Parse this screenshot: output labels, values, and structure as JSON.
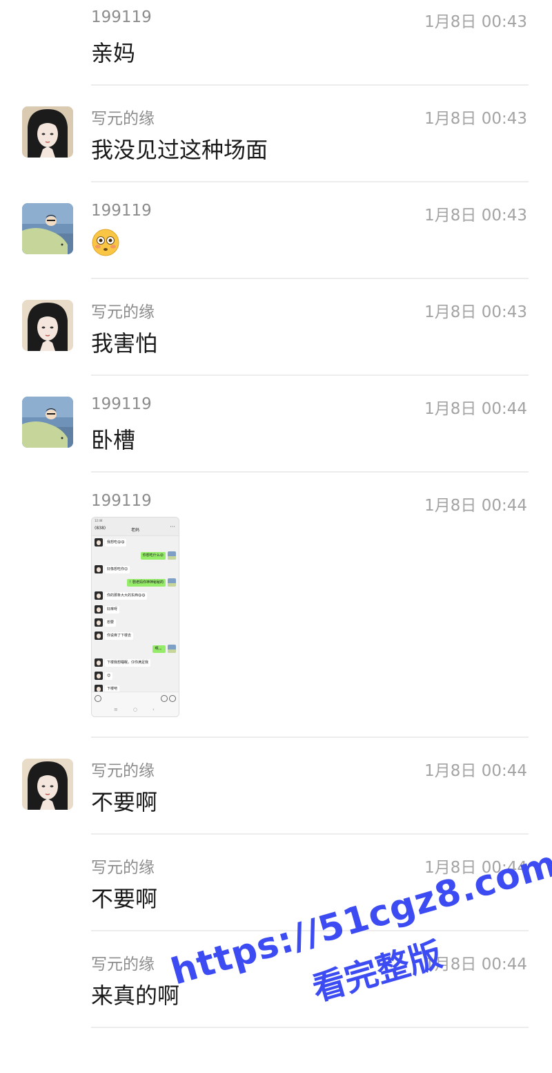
{
  "messages": [
    {
      "sender": "199119",
      "time": "1月8日 00:43",
      "text": "亲妈"
    },
    {
      "sender": "写元的缘",
      "time": "1月8日 00:43",
      "text": "我没见过这种场面"
    },
    {
      "sender": "199119",
      "time": "1月8日 00:43",
      "emoji": "flushed-face-emoji"
    },
    {
      "sender": "写元的缘",
      "time": "1月8日 00:43",
      "text": "我害怕"
    },
    {
      "sender": "199119",
      "time": "1月8日 00:44",
      "text": "卧槽"
    },
    {
      "sender": "199119",
      "time": "1月8日 00:44",
      "image": "chat-screenshot-thumbnail"
    },
    {
      "sender": "写元的缘",
      "time": "1月8日 00:44",
      "text": "不要啊"
    },
    {
      "sender": "写元的缘",
      "time": "1月8日 00:44",
      "text": "不要啊"
    },
    {
      "sender": "写元的缘",
      "time": "1月8日 00:44",
      "text": "来真的啊"
    }
  ],
  "thumbnail": {
    "status": "12:44",
    "back_label": "(838)",
    "title": "老妈",
    "more": "···",
    "rows": [
      {
        "side": "l",
        "text": "我想吃😋😋"
      },
      {
        "side": "r",
        "text": "你想吃什么😜"
      },
      {
        "side": "l",
        "text": "好像想吃你😊"
      },
      {
        "side": "r",
        "text": "！剧老妈你神神秘秘的"
      },
      {
        "side": "l",
        "text": "你的那条大大的东西😋😋"
      },
      {
        "side": "l",
        "text": "好痒呀"
      },
      {
        "side": "l",
        "text": "想要"
      },
      {
        "side": "l",
        "text": "你说痒了下楼去"
      },
      {
        "side": "r",
        "text": "啊。。"
      },
      {
        "side": "l",
        "text": "下楼我想睡眠，仔你满足我"
      },
      {
        "side": "l",
        "text": "😊"
      },
      {
        "side": "l",
        "text": "下楼吧"
      }
    ]
  },
  "watermark": {
    "url": "https://51cgz8.com",
    "text": "看完整版"
  },
  "colors": {
    "sender_text": "#8c8c8c",
    "time_text": "#a3a3a3",
    "message_text": "#191919",
    "divider": "#ececec",
    "watermark": "#3d4cf2",
    "bubble_self": "#95ec69"
  }
}
